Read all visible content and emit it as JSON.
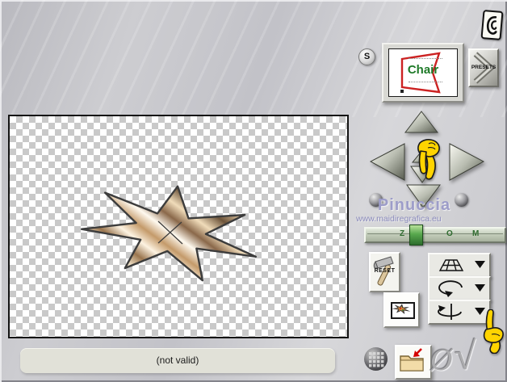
{
  "header": {
    "s_badge": "S",
    "thumbnail_text": "Chair",
    "presets_label": "PRESETS"
  },
  "watermark": {
    "name": "Pinuccia",
    "website": "www.maidiregrafica.eu"
  },
  "zoom_slider": {
    "word": "ZOOM",
    "letters": [
      "Z",
      "O",
      "M"
    ],
    "thumb_color": "#58a84e"
  },
  "tools": {
    "reset_label": "RESET"
  },
  "status": {
    "message": "(not valid)"
  },
  "actions": {
    "cancel_glyph": "Ø",
    "ok_glyph": "√"
  },
  "icons": {
    "logo": "ear-logo-icon",
    "nav": [
      "pan-up-icon",
      "pan-left-icon",
      "pan-right-icon",
      "pan-down-icon",
      "nudge-up-icon",
      "nudge-down-icon"
    ],
    "dropdowns": [
      "perspective-grid-icon",
      "rotate-plane-icon",
      "rotate-axis-icon"
    ],
    "misc": [
      "hammer-icon",
      "mini-star-icon",
      "grid-ball-icon",
      "import-folder-icon",
      "hand-down-icon",
      "hand-up-icon"
    ]
  },
  "colors": {
    "hand_yellow": "#ffd400",
    "zoom_green": "#2e6b2e",
    "thumbnail_red": "#cc2222",
    "chair_green": "#1e7a28",
    "watermark_lavender": "#9d9dc9",
    "status_bg": "#e1e1d8",
    "star_bronze": "#c49a6a"
  }
}
